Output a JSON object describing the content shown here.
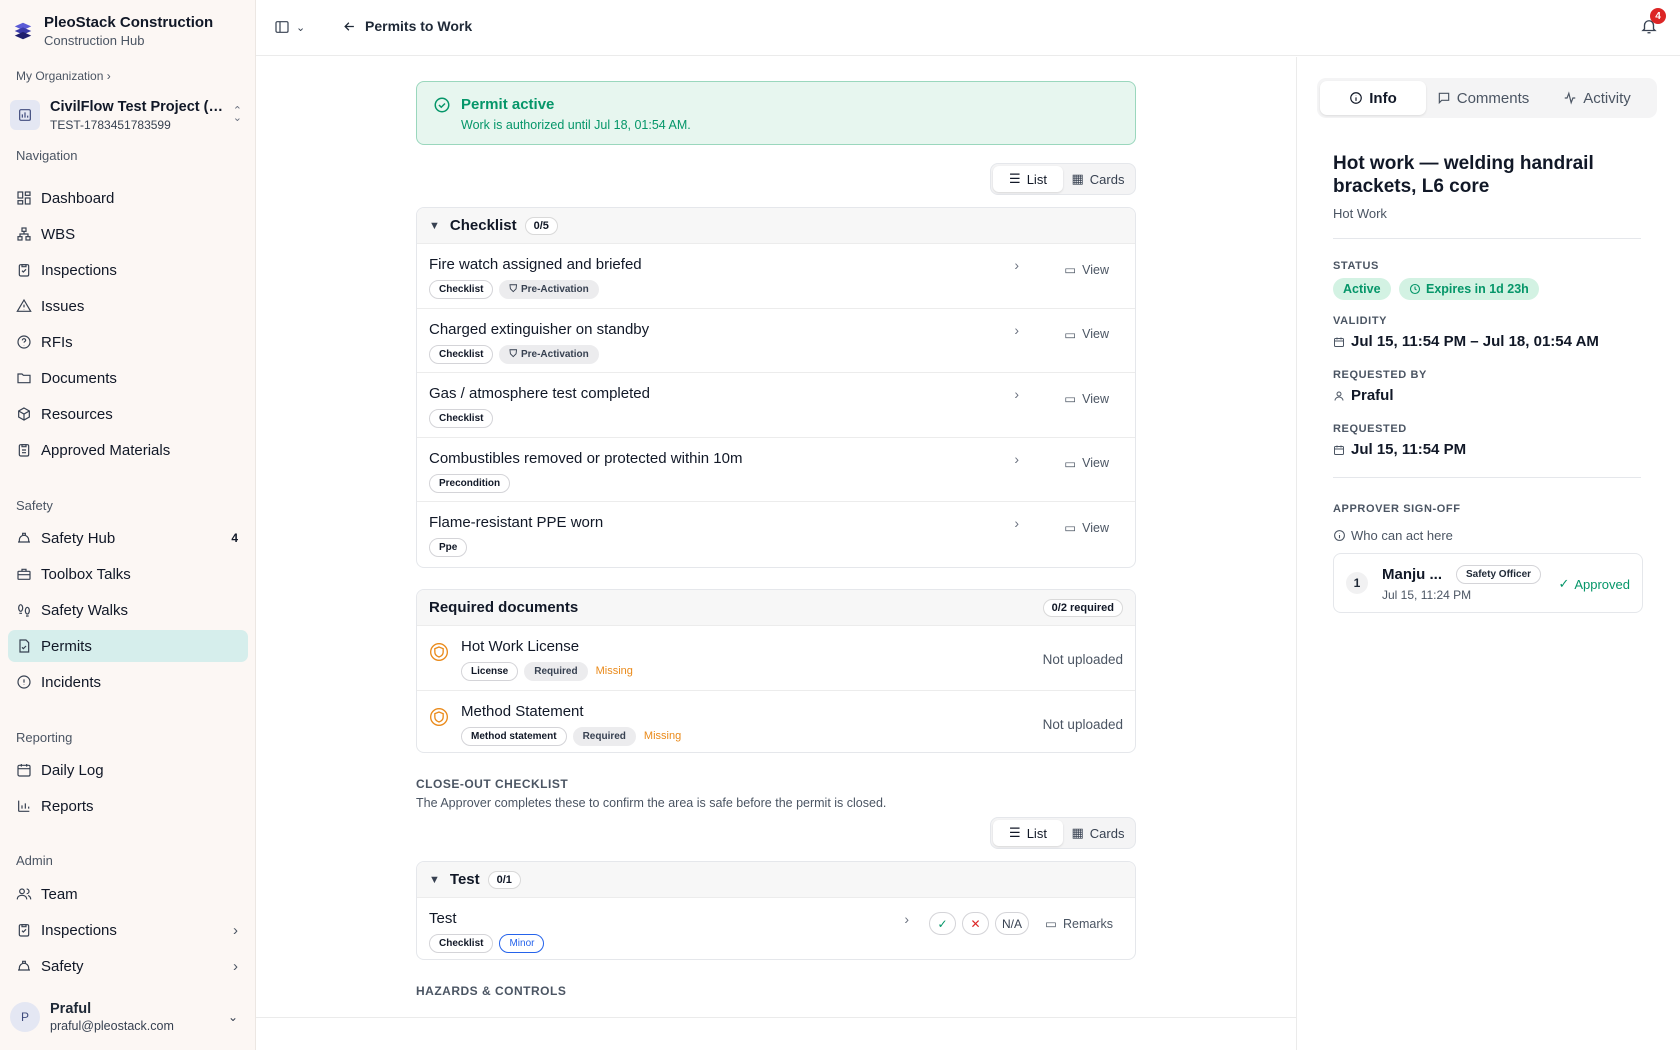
{
  "brand": {
    "name": "PleoStack Construction",
    "subtitle": "Construction Hub"
  },
  "org": {
    "crumb": "My Organization ›"
  },
  "project": {
    "name": "CivilFlow Test Project (U...",
    "code": "TEST-1783451783599"
  },
  "sections": {
    "navigation": "Navigation",
    "safety": "Safety",
    "reporting": "Reporting",
    "admin": "Admin"
  },
  "nav": {
    "dashboard": "Dashboard",
    "wbs": "WBS",
    "inspections": "Inspections",
    "issues": "Issues",
    "rfis": "RFIs",
    "documents": "Documents",
    "resources": "Resources",
    "approved_materials": "Approved Materials",
    "safety_hub": "Safety Hub",
    "safety_hub_badge": "4",
    "toolbox_talks": "Toolbox Talks",
    "safety_walks": "Safety Walks",
    "permits": "Permits",
    "incidents": "Incidents",
    "daily_log": "Daily Log",
    "reports": "Reports",
    "team": "Team",
    "admin_inspections": "Inspections",
    "admin_safety": "Safety"
  },
  "user": {
    "name": "Praful",
    "email": "praful@pleostack.com",
    "initial": "P"
  },
  "topbar": {
    "back_label": "Permits to Work",
    "notifications": "4"
  },
  "alert": {
    "title": "Permit active",
    "desc": "Work is authorized until Jul 18, 01:54 AM."
  },
  "view_toggle": {
    "list": "List",
    "cards": "Cards"
  },
  "checklist": {
    "title": "Checklist",
    "count": "0/5",
    "view_label": "View",
    "items": [
      {
        "title": "Fire watch assigned and briefed",
        "tag": "Checklist",
        "tag2": "Pre-Activation"
      },
      {
        "title": "Charged extinguisher on standby",
        "tag": "Checklist",
        "tag2": "Pre-Activation"
      },
      {
        "title": "Gas / atmosphere test completed",
        "tag": "Checklist"
      },
      {
        "title": "Combustibles removed or protected within 10m",
        "tag": "Precondition"
      },
      {
        "title": "Flame-resistant PPE worn",
        "tag": "Ppe"
      }
    ]
  },
  "documents": {
    "title": "Required documents",
    "count": "0/2 required",
    "status": "Not uploaded",
    "items": [
      {
        "title": "Hot Work License",
        "type": "License",
        "required": "Required",
        "state": "Missing"
      },
      {
        "title": "Method Statement",
        "type": "Method statement",
        "required": "Required",
        "state": "Missing"
      }
    ]
  },
  "closeout": {
    "label": "CLOSE-OUT CHECKLIST",
    "desc": "The Approver completes these to confirm the area is safe before the permit is closed.",
    "group": "Test",
    "count": "0/1",
    "item": {
      "title": "Test",
      "tag": "Checklist",
      "severity": "Minor",
      "na": "N/A",
      "remarks": "Remarks"
    }
  },
  "hazards": {
    "label": "HAZARDS & CONTROLS"
  },
  "panel": {
    "tabs": {
      "info": "Info",
      "comments": "Comments",
      "activity": "Activity"
    },
    "title": "Hot work — welding handrail brackets, L6 core",
    "type": "Hot Work",
    "status_label": "STATUS",
    "status": "Active",
    "expires": "Expires in 1d 23h",
    "validity_label": "VALIDITY",
    "validity": "Jul 15, 11:54 PM – Jul 18, 01:54 AM",
    "requested_by_label": "REQUESTED BY",
    "requested_by": "Praful",
    "requested_label": "REQUESTED",
    "requested": "Jul 15, 11:54 PM",
    "signoff_label": "APPROVER SIGN-OFF",
    "who": "Who can act here",
    "approver": {
      "num": "1",
      "name": "Manju ...",
      "role": "Safety Officer",
      "date": "Jul 15, 11:24 PM",
      "status": "Approved"
    }
  },
  "colors": {
    "accent": "#059669",
    "active_nav": "#d6eeec",
    "missing": "#ea8a1a",
    "alert": "#dc2626"
  }
}
